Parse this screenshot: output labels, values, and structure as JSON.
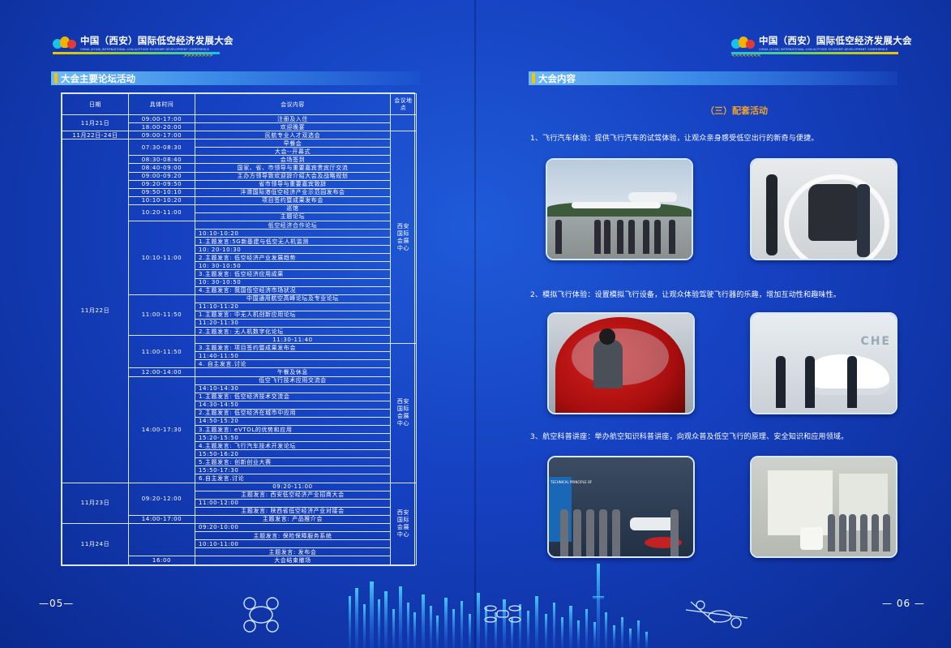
{
  "header": {
    "logo_title": "中国（西安）国际低空经济发展大会",
    "logo_subtitle": "CHINA (XI'AN) INTERNATIONAL LOW-ALTITUDE ECONOMY DEVELOPMENT CONFERENCE",
    "arrows_left": ">>>>>>>>",
    "arrows_right": "<<<<<<<<"
  },
  "left_page": {
    "section_title": "大会主要论坛活动",
    "page_number": "05",
    "table": {
      "headers": [
        "日期",
        "具体时间",
        "会议内容",
        "会议地点"
      ],
      "venue": "西安国际会展中心",
      "rows": [
        [
          "11月21日",
          "09:00-17:00",
          "注册及入住"
        ],
        [
          "",
          "18:00-20:00",
          "欢迎晚宴"
        ],
        [
          "11月22日-24日",
          "09:00-17:00",
          "民航专业人才双选会"
        ],
        [
          "11月22日",
          "07:30-08:30",
          "早餐会"
        ],
        [
          "",
          "",
          "大会--开幕式"
        ],
        [
          "",
          "08:30-08:40",
          "会场签到"
        ],
        [
          "",
          "08:40-09:00",
          "国家、省、市领导与重要嘉宾贵宾厅交流"
        ],
        [
          "",
          "09:00-09:20",
          "主办方领导致欢迎辞介绍大会及战略规划"
        ],
        [
          "",
          "09:20-09:50",
          "省市领导与重要嘉宾致辞"
        ],
        [
          "",
          "09:50-10:10",
          "沣渭国际港低空经济产业示范园发布会"
        ],
        [
          "",
          "10:10-10:20",
          "项目签约暨成果发布会"
        ],
        [
          "",
          "10:20-11:00",
          "巡馆"
        ],
        [
          "",
          "",
          "主题论坛"
        ],
        [
          "",
          "10:10-11:00",
          "低空经济合作论坛"
        ],
        [
          "",
          "",
          "10:10-10:20"
        ],
        [
          "",
          "",
          "1.主题发言:5G新基建与低空无人机监测"
        ],
        [
          "",
          "",
          "10: 20-10:30"
        ],
        [
          "",
          "",
          "2.主题发言: 低空经济产业发展趋势"
        ],
        [
          "",
          "",
          "10: 30-10:50"
        ],
        [
          "",
          "",
          "3.主题发言: 低空经济应用成果"
        ],
        [
          "",
          "",
          "10: 30-10:50"
        ],
        [
          "",
          "",
          "4.主题发言: 我国低空经济市场状况"
        ],
        [
          "",
          "11:00-11:50",
          "中国通用航空高峰论坛及专业论坛"
        ],
        [
          "",
          "",
          "11:10-11:20"
        ],
        [
          "",
          "",
          "1.主题发言: 中无人机创新应用论坛"
        ],
        [
          "",
          "",
          "11:20-11:30"
        ],
        [
          "",
          "",
          "2.主题发言: 无人机数字化论坛"
        ],
        [
          "",
          "11:00-11:50",
          "11:30-11:40"
        ],
        [
          "",
          "",
          "3.主题发言: 项目签约暨成果发布会"
        ],
        [
          "",
          "",
          "11:40-11:50"
        ],
        [
          "",
          "",
          "4. 自主发言.讨论"
        ],
        [
          "",
          "12:00-14:00",
          "午餐及休息"
        ],
        [
          "",
          "14:00-17:30",
          "低空飞行技术应用交流会"
        ],
        [
          "",
          "",
          "14:10-14:30"
        ],
        [
          "",
          "",
          "1.主题发言: 低空经济技术交流会"
        ],
        [
          "",
          "",
          "14:30-14:50"
        ],
        [
          "",
          "",
          "2.主题发言: 低空经济在城市中应用"
        ],
        [
          "",
          "",
          "14:50-15:20"
        ],
        [
          "",
          "",
          "3.主题发言: eVTOL的优势和应用"
        ],
        [
          "",
          "",
          "15:20-15:50"
        ],
        [
          "",
          "",
          "4.主题发言: 飞行汽车技术开发论坛"
        ],
        [
          "",
          "",
          "15:50-16:20"
        ],
        [
          "",
          "",
          "5.主题发言: 创新创业大赛"
        ],
        [
          "",
          "",
          "15:50-17:30"
        ],
        [
          "",
          "",
          "6.自主发言.讨论"
        ],
        [
          "11月23日",
          "09:20-12:00",
          "09:20-11:00"
        ],
        [
          "",
          "",
          "主题发言: 西安低空经济产业招商大会"
        ],
        [
          "",
          "",
          "11:00-12:00"
        ],
        [
          "",
          "",
          "主题发言: 陕西省低空经济产业对接会"
        ],
        [
          "",
          "14:00-17:00",
          "主题发言: 产品推介会"
        ],
        [
          "11月24日",
          "",
          "09:20-10:00"
        ],
        [
          "",
          "",
          "主题发言: 保险保障服务系统"
        ],
        [
          "",
          "",
          "10:10-11:00"
        ],
        [
          "",
          "",
          "主题发言: 发布会"
        ],
        [
          "",
          "16:00",
          "大会结束撤场"
        ]
      ]
    }
  },
  "right_page": {
    "section_title": "大会内容",
    "page_number": "06",
    "subtitle": "（三）配套活动",
    "items": [
      "1、飞行汽车体验：提供飞行汽车的试驾体验，让观众亲身感受低空出行的新奇与便捷。",
      "2、模拟飞行体验：设置模拟飞行设备，让观众体验驾驶飞行器的乐趣，增加互动性和趣味性。",
      "3、航空科普讲座：举办航空知识科普讲座，向观众普及低空飞行的原理、安全知识和应用领域。"
    ],
    "photo4_sign": "CHE",
    "photo5_sign": "TECHNICAL PRINCIPLE OF"
  },
  "colors": {
    "background": "#1540c0",
    "accent_orange": "#f0a02a",
    "accent_yellow": "#f4c400",
    "line": "#d8e6ff"
  }
}
